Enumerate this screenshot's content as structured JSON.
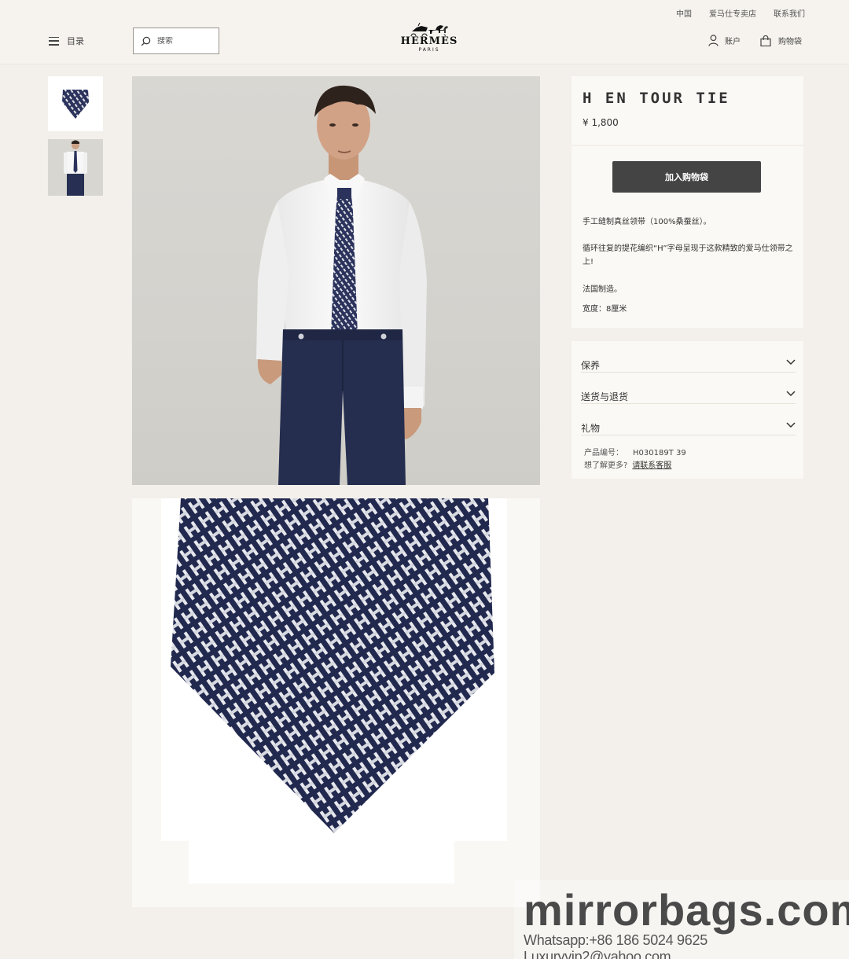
{
  "utility_nav": [
    "中国",
    "爱马仕专卖店",
    "联系我们"
  ],
  "header": {
    "menu_label": "目录",
    "search_placeholder": "搜索",
    "logo_name": "HERMÈS",
    "logo_city": "PARIS",
    "account_label": "账户",
    "cart_label": "购物袋"
  },
  "product": {
    "title": "H EN TOUR TIE",
    "price": "¥ 1,800",
    "add_to_bag": "加入购物袋",
    "description": [
      "手工缝制真丝领带（100%桑蚕丝）。",
      "循环往复的提花编织“H”字母呈现于这款精致的爱马仕领带之上!",
      "法国制造。",
      "宽度：8厘米"
    ]
  },
  "accordion": [
    "保养",
    "送货与退货",
    "礼物"
  ],
  "reference": {
    "label": "产品编号：",
    "code": "H030189T 39",
    "more_prompt": "想了解更多?",
    "contact_link": "请联系客服"
  },
  "watermark": {
    "domain": "mirrorbags.com",
    "contact": "Whatsapp:+86 186 5024 9625   Luxuryvip2@yahoo.com"
  },
  "colors": {
    "background": "#f3f0eb",
    "panel": "#fbf9f5",
    "button": "#444444",
    "tie_navy": "#22294f"
  }
}
